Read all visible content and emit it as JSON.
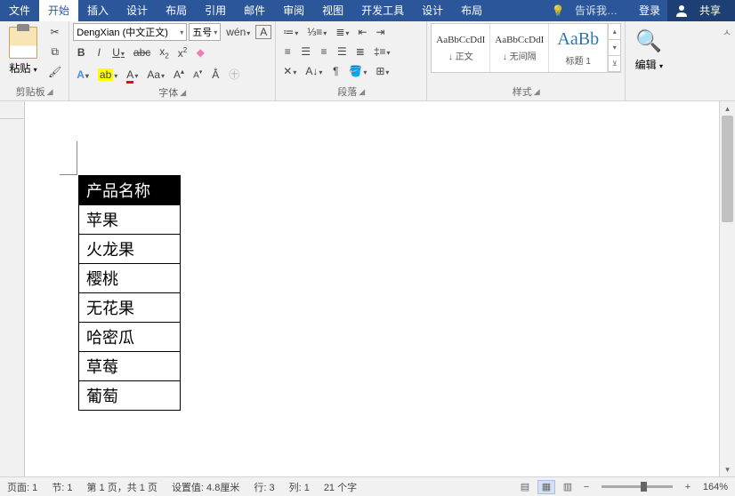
{
  "menu": {
    "items": [
      "文件",
      "开始",
      "插入",
      "设计",
      "布局",
      "引用",
      "邮件",
      "审阅",
      "视图",
      "开发工具",
      "设计",
      "布局"
    ],
    "active": 1,
    "tell_me": "告诉我…",
    "login": "登录",
    "share": "共享"
  },
  "ribbon": {
    "clipboard": {
      "paste": "粘贴",
      "label": "剪贴板"
    },
    "font": {
      "name": "DengXian (中文正文)",
      "size": "五号",
      "label": "字体"
    },
    "paragraph": {
      "label": "段落"
    },
    "styles": {
      "items": [
        {
          "preview": "AaBbCcDdI",
          "name": "↓ 正文"
        },
        {
          "preview": "AaBbCcDdI",
          "name": "↓ 无间隔"
        },
        {
          "preview": "AaBb",
          "name": "标题 1"
        }
      ],
      "label": "样式"
    },
    "editing": {
      "label": "编辑"
    }
  },
  "table": {
    "header": "产品名称",
    "rows": [
      "苹果",
      "火龙果",
      "樱桃",
      "无花果",
      "哈密瓜",
      "草莓",
      "葡萄"
    ]
  },
  "status": {
    "page": "页面: 1",
    "section": "节: 1",
    "page_of": "第 1 页，共 1 页",
    "setting": "设置值: 4.8厘米",
    "line": "行: 3",
    "col": "列: 1",
    "words": "21 个字",
    "zoom": "164%"
  }
}
